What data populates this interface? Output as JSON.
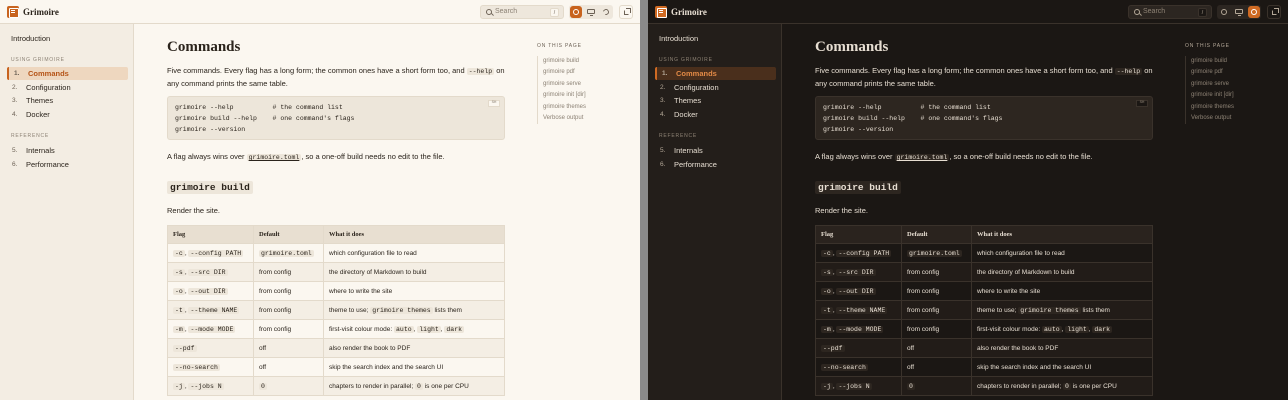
{
  "app": {
    "title": "Grimoire"
  },
  "search": {
    "placeholder": "Search",
    "shortcut": "/"
  },
  "sidebar": {
    "intro": "Introduction",
    "section1": "Using Grimoire",
    "items1": [
      {
        "n": "1.",
        "label": "Commands"
      },
      {
        "n": "2.",
        "label": "Configuration"
      },
      {
        "n": "3.",
        "label": "Themes"
      },
      {
        "n": "4.",
        "label": "Docker"
      }
    ],
    "section2": "Reference",
    "items2": [
      {
        "n": "5.",
        "label": "Internals"
      },
      {
        "n": "6.",
        "label": "Performance"
      }
    ]
  },
  "page": {
    "title": "Commands",
    "intro_a": "Five commands. Every flag has a long form; the common ones have a short form too, and ",
    "intro_code": "--help",
    "intro_b": " on any command prints the same table.",
    "code_lines": [
      "grimoire --help          # the command list",
      "grimoire build --help    # one command's flags",
      "grimoire --version"
    ],
    "copy_label": "SH",
    "flag_a": "A flag always wins over ",
    "flag_code": "grimoire.toml",
    "flag_b": ", so a one-off build needs no edit to the file.",
    "section_title": "grimoire build",
    "section_desc": "Render the site."
  },
  "table": {
    "headers": [
      "Flag",
      "Default",
      "What it does"
    ],
    "rows": [
      {
        "flag": [
          [
            "-c",
            1
          ],
          [
            ", ",
            0
          ],
          [
            "--config PATH",
            1
          ]
        ],
        "def": [
          [
            "grimoire.toml",
            1
          ]
        ],
        "what": [
          [
            "which configuration file to read",
            0
          ]
        ]
      },
      {
        "flag": [
          [
            "-s",
            1
          ],
          [
            ", ",
            0
          ],
          [
            "--src DIR",
            1
          ]
        ],
        "def": [
          [
            "from config",
            0
          ]
        ],
        "what": [
          [
            "the directory of Markdown to build",
            0
          ]
        ]
      },
      {
        "flag": [
          [
            "-o",
            1
          ],
          [
            ", ",
            0
          ],
          [
            "--out DIR",
            1
          ]
        ],
        "def": [
          [
            "from config",
            0
          ]
        ],
        "what": [
          [
            "where to write the site",
            0
          ]
        ]
      },
      {
        "flag": [
          [
            "-t",
            1
          ],
          [
            ", ",
            0
          ],
          [
            "--theme NAME",
            1
          ]
        ],
        "def": [
          [
            "from config",
            0
          ]
        ],
        "what": [
          [
            "theme to use; ",
            0
          ],
          [
            "grimoire themes",
            1
          ],
          [
            " lists them",
            0
          ]
        ]
      },
      {
        "flag": [
          [
            "-m",
            1
          ],
          [
            ", ",
            0
          ],
          [
            "--mode MODE",
            1
          ]
        ],
        "def": [
          [
            "from config",
            0
          ]
        ],
        "what": [
          [
            "first-visit colour mode: ",
            0
          ],
          [
            "auto",
            1
          ],
          [
            ", ",
            0
          ],
          [
            "light",
            1
          ],
          [
            ", ",
            0
          ],
          [
            "dark",
            1
          ]
        ]
      },
      {
        "flag": [
          [
            "--pdf",
            1
          ]
        ],
        "def": [
          [
            "off",
            0
          ]
        ],
        "what": [
          [
            "also render the book to PDF",
            0
          ]
        ]
      },
      {
        "flag": [
          [
            "--no-search",
            1
          ]
        ],
        "def": [
          [
            "off",
            0
          ]
        ],
        "what": [
          [
            "skip the search index and the search UI",
            0
          ]
        ]
      },
      {
        "flag": [
          [
            "-j",
            1
          ],
          [
            ", ",
            0
          ],
          [
            "--jobs N",
            1
          ]
        ],
        "def": [
          [
            "0",
            1
          ]
        ],
        "what": [
          [
            "chapters to render in parallel; ",
            0
          ],
          [
            "0",
            1
          ],
          [
            " is one per CPU",
            0
          ]
        ]
      }
    ]
  },
  "toc": {
    "heading": "On this page",
    "items": [
      "grimoire build",
      "grimoire pdf",
      "grimoire serve",
      "grimoire init [dir]",
      "grimoire themes",
      "Verbose output"
    ]
  },
  "modes": {
    "light": "light",
    "dark": "dark"
  }
}
